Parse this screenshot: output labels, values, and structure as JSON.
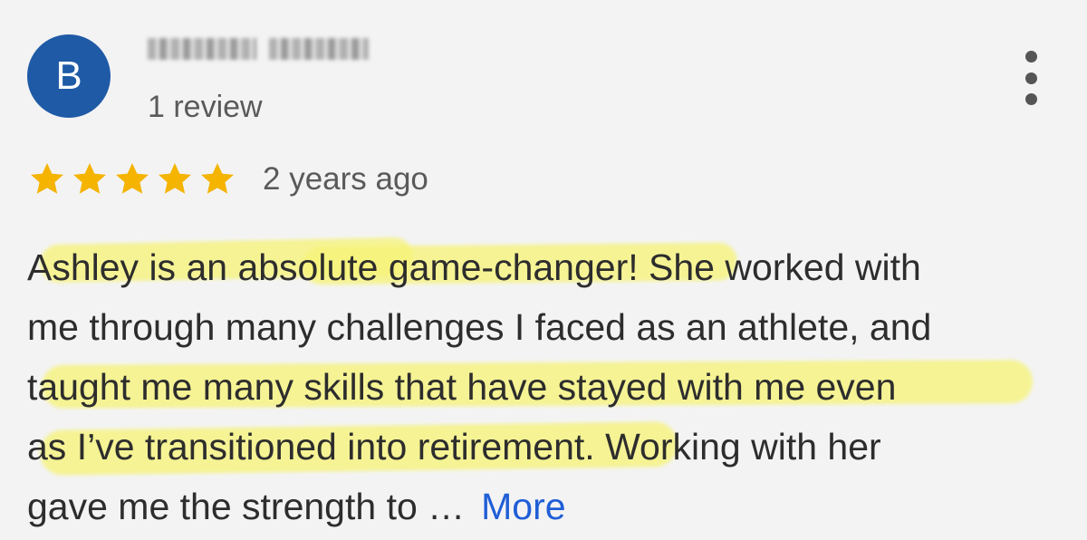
{
  "review": {
    "avatar_initial": "B",
    "review_count": "1 review",
    "rating": 5,
    "rating_max": 5,
    "time_ago": "2 years ago",
    "text_lines": [
      "Ashley is an absolute game-changer! She worked with",
      "me through many challenges I faced as an athlete, and",
      "taught me many skills that have stayed with me even",
      "as I’ve transitioned into retirement. Working with her",
      "gave me the strength to …"
    ],
    "more_label": "More"
  },
  "icons": {
    "star": "star-icon",
    "menu": "more-vert-icon"
  },
  "colors": {
    "avatar_bg": "#1f5aa6",
    "star": "#f4b400",
    "highlight": "#f6f478",
    "link": "#1f5ed6",
    "background": "#f3f3f4"
  }
}
